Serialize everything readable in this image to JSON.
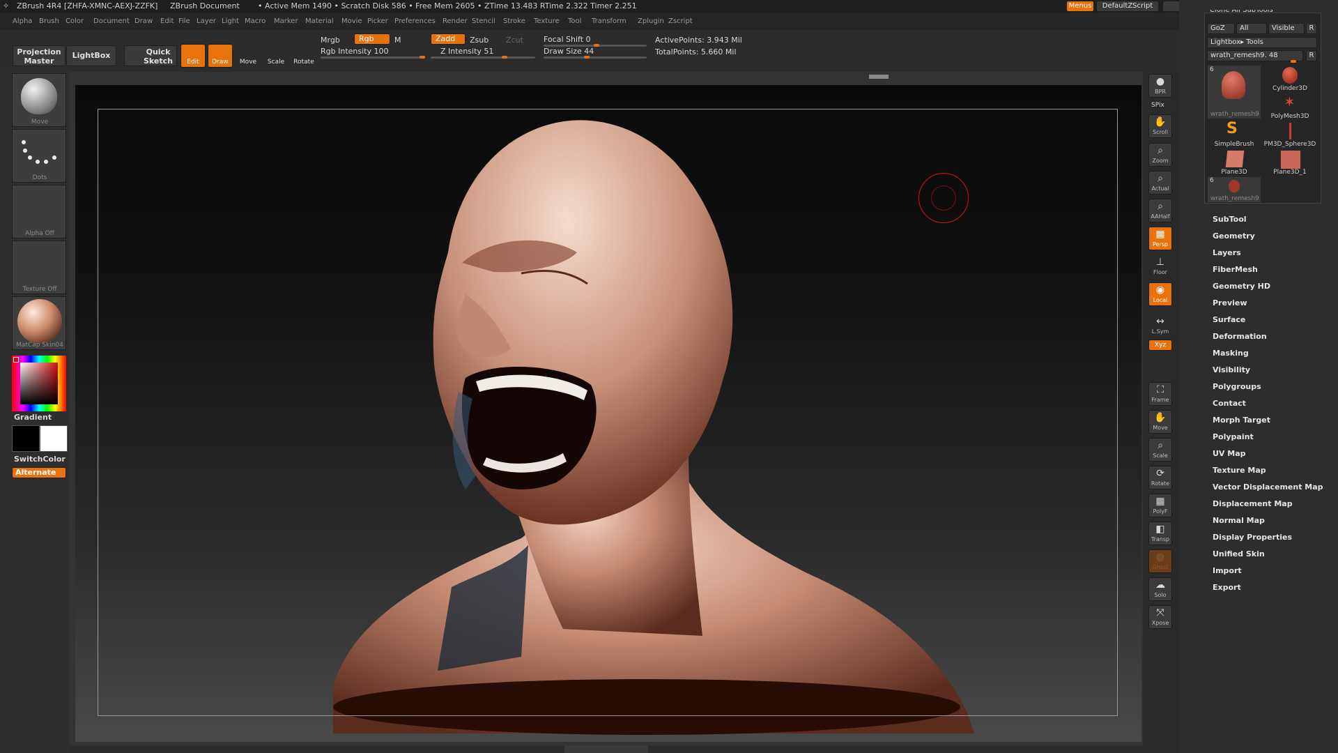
{
  "titlebar": {
    "app": "ZBrush 4R4 [ZHFA-XMNC-AEXJ-ZZFK]",
    "doc": "ZBrush Document",
    "stats": "• Active Mem 1490 • Scratch Disk 586 • Free Mem 2605 • ZTime 13.483 RTime 2.322 Timer 2.251",
    "menus_button": "Menus",
    "script": "DefaultZScript"
  },
  "menubar": {
    "items": [
      "Alpha",
      "Brush",
      "Color",
      "Document",
      "Draw",
      "Edit",
      "File",
      "Layer",
      "Light",
      "Macro",
      "Marker",
      "Material",
      "Movie",
      "Picker",
      "Preferences",
      "Render",
      "Stencil",
      "Stroke",
      "Texture",
      "Tool",
      "Transform",
      "Zplugin",
      "Zscript"
    ]
  },
  "toolbar": {
    "projection_master": "Projection Master",
    "lightbox": "LightBox",
    "quick_sketch": "Quick Sketch",
    "edit": "Edit",
    "draw": "Draw",
    "move": "Move",
    "scale": "Scale",
    "rotate": "Rotate",
    "mrgb": "Mrgb",
    "rgb": "Rgb",
    "m": "M",
    "rgb_intensity": "Rgb Intensity 100",
    "zadd": "Zadd",
    "zsub": "Zsub",
    "zcut": "Zcut",
    "z_intensity": "Z Intensity 51",
    "focal_shift": "Focal Shift 0",
    "draw_size": "Draw Size 44",
    "active_points": "ActivePoints: 3.943 Mil",
    "total_points": "TotalPoints: 5.660 Mil"
  },
  "leftshelf": {
    "brush": "Move",
    "stroke": "Dots",
    "alpha": "Alpha Off",
    "texture": "Texture Off",
    "material": "MatCap Skin04",
    "gradient": "Gradient",
    "switch_color": "SwitchColor",
    "alternate": "Alternate"
  },
  "rightshelf": {
    "buttons": [
      "BPR",
      "SPix",
      "Scroll",
      "Zoom",
      "Actual",
      "AAHalf",
      "Persp",
      "Floor",
      "Local",
      "L.Sym",
      "Xyz",
      "Frame",
      "Move",
      "Scale",
      "Rotate",
      "PolyF",
      "Transp",
      "Ghost",
      "Solo",
      "Xpose"
    ]
  },
  "toolpalette": {
    "header_partial": "Clone All SubTools",
    "goz": "GoZ",
    "all": "All",
    "visible": "Visible",
    "r": "R",
    "lightbox_tools": "Lightbox▸ Tools",
    "current_tool": "wrath_remesh9. 48",
    "tiles": [
      {
        "name": "wrath_remesh9",
        "count": "6"
      },
      {
        "name": "Cylinder3D"
      },
      {
        "name": "PolyMesh3D"
      },
      {
        "name": "SimpleBrush"
      },
      {
        "name": "PM3D_Sphere3D"
      },
      {
        "name": "Plane3D"
      },
      {
        "name": "Plane3D_1"
      },
      {
        "name": "wrath_remesh9",
        "count": "6"
      }
    ],
    "sections": [
      "SubTool",
      "Geometry",
      "Layers",
      "FiberMesh",
      "Geometry HD",
      "Preview",
      "Surface",
      "Deformation",
      "Masking",
      "Visibility",
      "Polygroups",
      "Contact",
      "Morph Target",
      "Polypaint",
      "UV Map",
      "Texture Map",
      "Vector Displacement Map",
      "Displacement Map",
      "Normal Map",
      "Display Properties",
      "Unified Skin",
      "Import",
      "Export"
    ]
  },
  "colors": {
    "accent": "#e8720c",
    "skin": "#c48a72",
    "cursor_ring": "#cc1a1a"
  }
}
